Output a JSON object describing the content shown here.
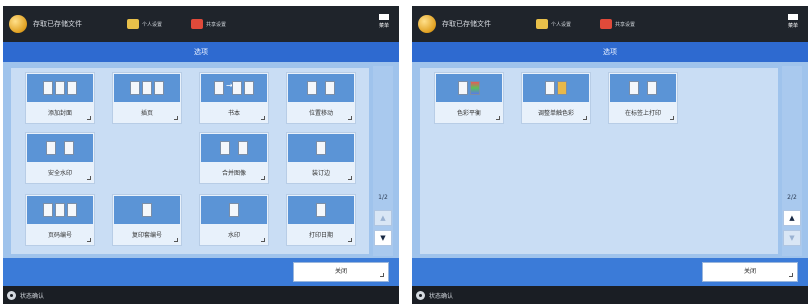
{
  "left_panel": {
    "app_title": "存取已存储文件",
    "toolbar": {
      "personal_label": "个人设置",
      "shared_label": "共享设置"
    },
    "menu_label": "菜单",
    "screen_title": "选项",
    "tiles": [
      {
        "label": "添加封面"
      },
      {
        "label": "插页"
      },
      {
        "label": "书本"
      },
      {
        "label": "位置移动"
      },
      {
        "label": "安全水印"
      },
      {
        "label": "合并图像"
      },
      {
        "label": "装订边"
      },
      {
        "label": "页码编号"
      },
      {
        "label": "复印套编号"
      },
      {
        "label": "水印"
      },
      {
        "label": "打印日期"
      }
    ],
    "page_indicator": "1/2",
    "close_label": "关闭",
    "status_label": "状态确认"
  },
  "right_panel": {
    "app_title": "存取已存储文件",
    "toolbar": {
      "personal_label": "个人设置",
      "shared_label": "共享设置"
    },
    "menu_label": "菜单",
    "screen_title": "选项",
    "tiles": [
      {
        "label": "色彩平衡"
      },
      {
        "label": "调整单触色彩"
      },
      {
        "label": "在标签上打印"
      }
    ],
    "page_indicator": "2/2",
    "close_label": "关闭",
    "status_label": "状态确认"
  },
  "colors": {
    "title_bar": "#2e6ad0",
    "content_bg": "#9fc3ec",
    "tile_icon_bg": "#5b94d6",
    "footer_bg": "#3b7bd8",
    "top_bar": "#1f242b"
  }
}
